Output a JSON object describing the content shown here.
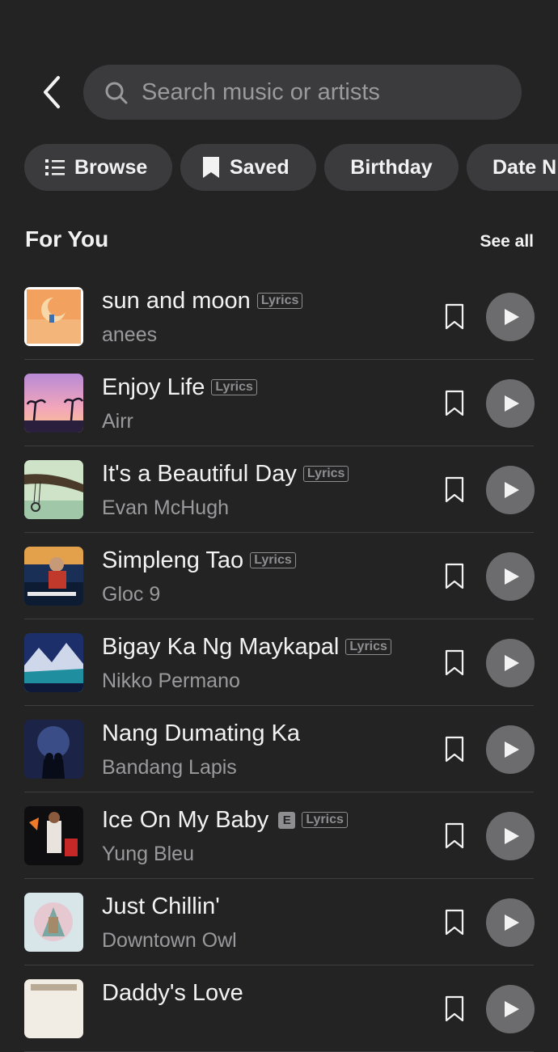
{
  "search": {
    "placeholder": "Search music or artists"
  },
  "chips": [
    {
      "label": "Browse",
      "icon": "list-icon"
    },
    {
      "label": "Saved",
      "icon": "bookmark-icon"
    },
    {
      "label": "Birthday"
    },
    {
      "label": "Date N"
    }
  ],
  "section": {
    "title": "For You",
    "see_all": "See all"
  },
  "badges": {
    "lyrics": "Lyrics",
    "explicit": "E"
  },
  "songs": [
    {
      "title": "sun and moon",
      "artist": "anees",
      "explicit": false,
      "lyrics": true
    },
    {
      "title": "Enjoy Life",
      "artist": "Airr",
      "explicit": false,
      "lyrics": true
    },
    {
      "title": "It's a Beautiful Day",
      "artist": "Evan McHugh",
      "explicit": false,
      "lyrics": true
    },
    {
      "title": "Simpleng Tao",
      "artist": "Gloc 9",
      "explicit": false,
      "lyrics": true
    },
    {
      "title": "Bigay Ka Ng Maykapal",
      "artist": "Nikko Permano",
      "explicit": false,
      "lyrics": true
    },
    {
      "title": "Nang Dumating Ka",
      "artist": "Bandang Lapis",
      "explicit": false,
      "lyrics": false
    },
    {
      "title": "Ice On My Baby",
      "artist": "Yung Bleu",
      "explicit": true,
      "lyrics": true
    },
    {
      "title": "Just Chillin'",
      "artist": "Downtown Owl",
      "explicit": false,
      "lyrics": false
    },
    {
      "title": "Daddy's Love",
      "artist": "",
      "explicit": false,
      "lyrics": false
    }
  ],
  "colors": {
    "background": "#232324",
    "surface": "#3b3b3d",
    "play": "#6c6c6e",
    "muted": "#9a9a9c"
  }
}
